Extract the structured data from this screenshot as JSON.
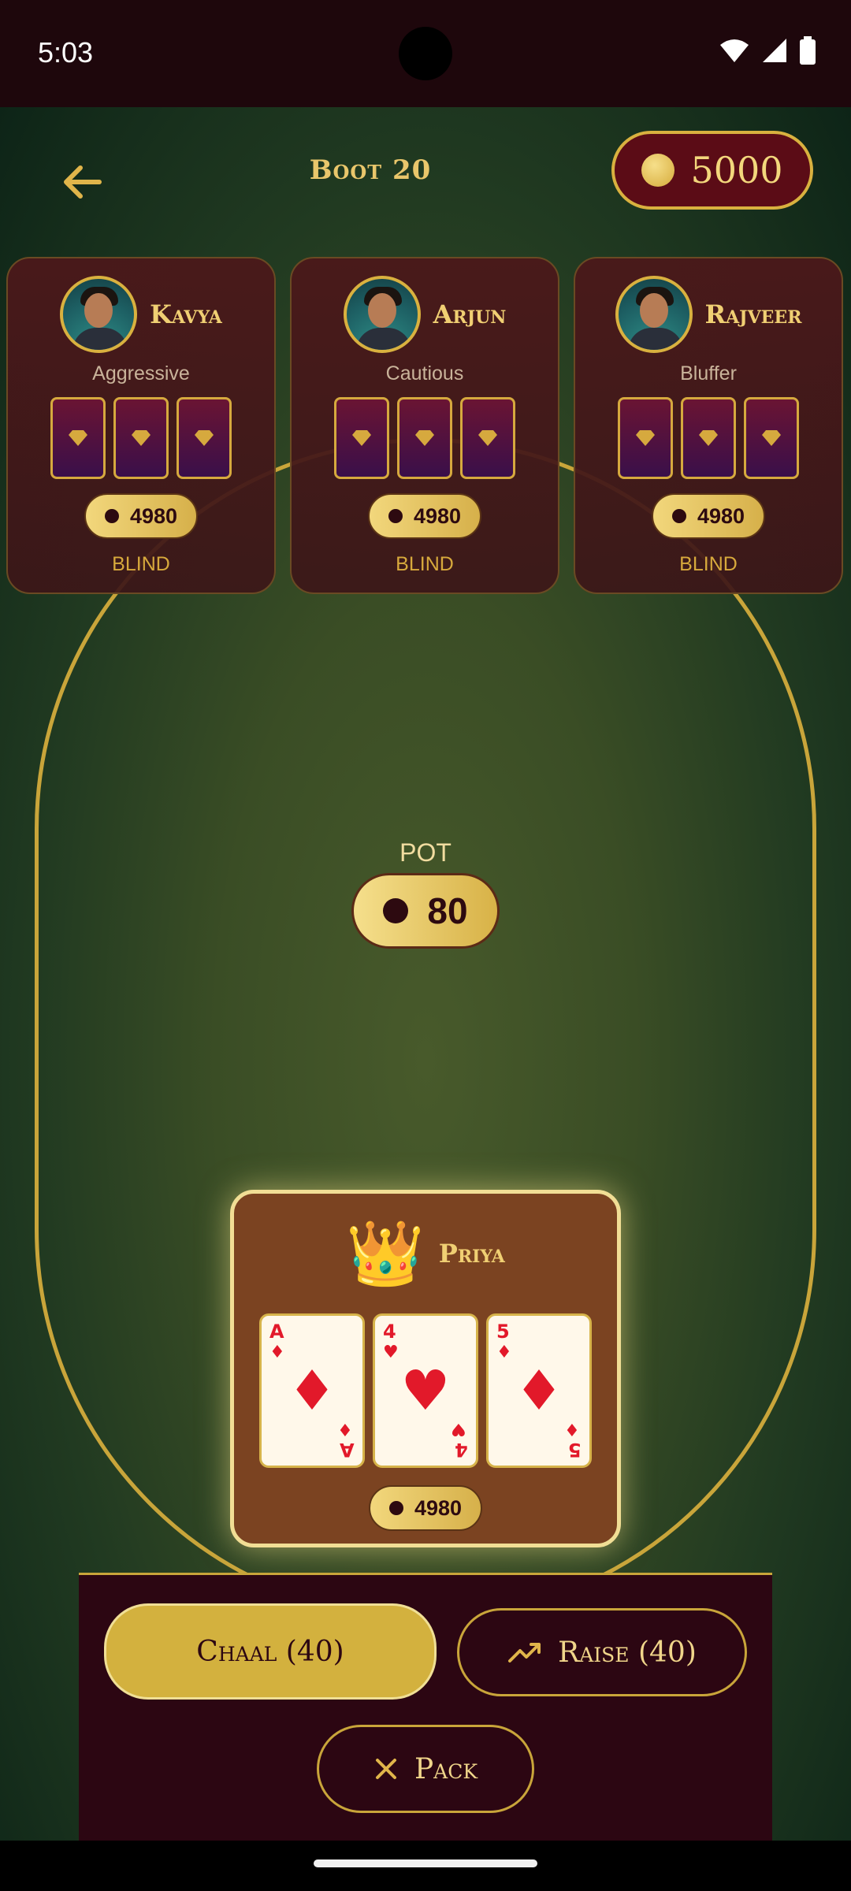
{
  "status_bar": {
    "time": "5:03"
  },
  "header": {
    "title": "Boot 20",
    "balance": "5000"
  },
  "opponents": [
    {
      "name": "Kavya",
      "style": "Aggressive",
      "chips": "4980",
      "status": "BLIND"
    },
    {
      "name": "Arjun",
      "style": "Cautious",
      "chips": "4980",
      "status": "BLIND"
    },
    {
      "name": "Rajveer",
      "style": "Bluffer",
      "chips": "4980",
      "status": "BLIND"
    }
  ],
  "pot": {
    "label": "POT",
    "value": "80"
  },
  "player": {
    "name": "Priya",
    "icon": "crown-icon",
    "chips": "4980",
    "cards": [
      {
        "rank": "A",
        "suit": "♦"
      },
      {
        "rank": "4",
        "suit": "♥"
      },
      {
        "rank": "5",
        "suit": "♦"
      }
    ]
  },
  "actions": {
    "chaal": "Chaal (40)",
    "raise": "Raise (40)",
    "pack": "Pack"
  },
  "colors": {
    "gold": "#d3b13e",
    "maroon": "#2c0612",
    "felt": "#485a2b",
    "card_red": "#e2192a"
  }
}
